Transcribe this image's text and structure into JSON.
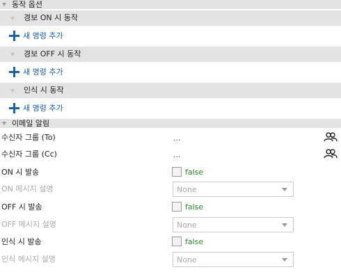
{
  "action_options": {
    "title": "동작 옵션",
    "groups": [
      {
        "label": "경보 ON 시 동작",
        "add_label": "새 명령 추가"
      },
      {
        "label": "경보 OFF 시 동작",
        "add_label": "새 명령 추가"
      },
      {
        "label": "인식 시 동작",
        "add_label": "새 명령 추가"
      }
    ]
  },
  "email": {
    "title": "이메일 알림",
    "recipients_to": {
      "label": "수신자 그룹 (To)",
      "value": "..."
    },
    "recipients_cc": {
      "label": "수신자 그룹 (Cc)",
      "value": "..."
    },
    "on_send": {
      "label": "ON 시 발송",
      "value": "false"
    },
    "on_message": {
      "label": "ON 메시지 설명",
      "value": "None"
    },
    "off_send": {
      "label": "OFF 시 발송",
      "value": "false"
    },
    "off_message": {
      "label": "OFF 메시지 설명",
      "value": "None"
    },
    "detect_send": {
      "label": "인식 시 발송",
      "value": "false"
    },
    "detect_message": {
      "label": "인식 메시지 설명",
      "value": "None"
    }
  },
  "colors": {
    "accent": "#1c5ea8",
    "false_value": "#2e8b2e",
    "header_bg": "#e3e3e3"
  },
  "icons": {
    "expand": "triangle-down",
    "add": "plus",
    "recipients": "people-icon"
  }
}
